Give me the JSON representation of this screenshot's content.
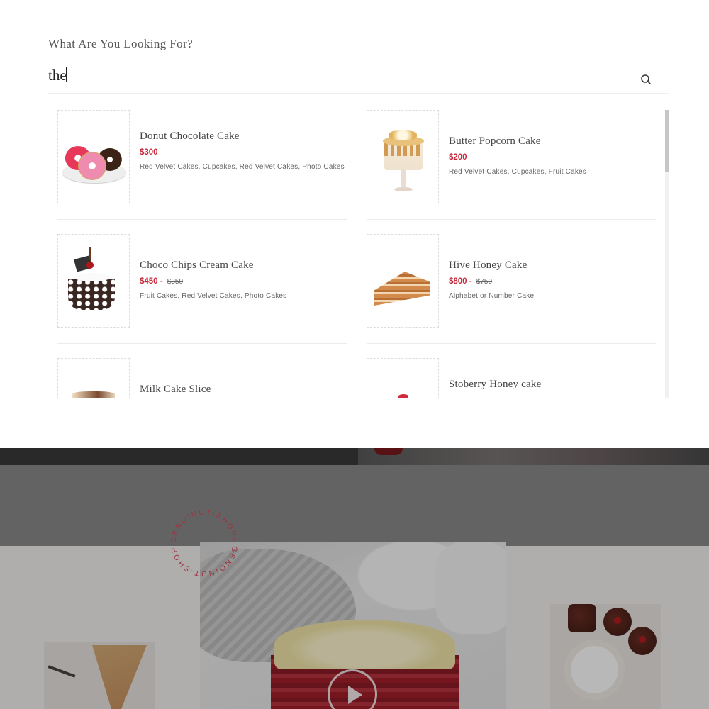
{
  "search": {
    "label": "What Are You Looking For?",
    "query": "the",
    "button_icon": "search-icon"
  },
  "results": [
    {
      "name": "Donut Chocolate Cake",
      "price": "$300",
      "old_price": "",
      "categories": "Red Velvet Cakes, Cupcakes, Red Velvet Cakes, Photo Cakes",
      "image": "donuts"
    },
    {
      "name": "Butter Popcorn Cake",
      "price": "$200",
      "old_price": "",
      "categories": "Red Velvet Cakes, Cupcakes, Fruit Cakes",
      "image": "popcorn-cake"
    },
    {
      "name": "Choco Chips Cream Cake",
      "price": "$450 -",
      "old_price": "$350",
      "categories": "Fruit Cakes, Red Velvet Cakes, Photo Cakes",
      "image": "choco-cake-slice"
    },
    {
      "name": "Hive Honey Cake",
      "price": "$800 -",
      "old_price": "$750",
      "categories": "Alphabet or Number Cake",
      "image": "honey-cake-wedge"
    },
    {
      "name": "Milk Cake Slice",
      "price": "",
      "old_price": "",
      "categories": "",
      "image": "milk-cake-slice"
    },
    {
      "name": "Stoberry Honey cake",
      "price": "",
      "old_price": "",
      "categories": "",
      "image": "strawberry-cake"
    }
  ],
  "background": {
    "stamp_text": "GENOINUT-SHOP- GENOINUT-SHOP-",
    "accent_color": "#c8293a"
  }
}
